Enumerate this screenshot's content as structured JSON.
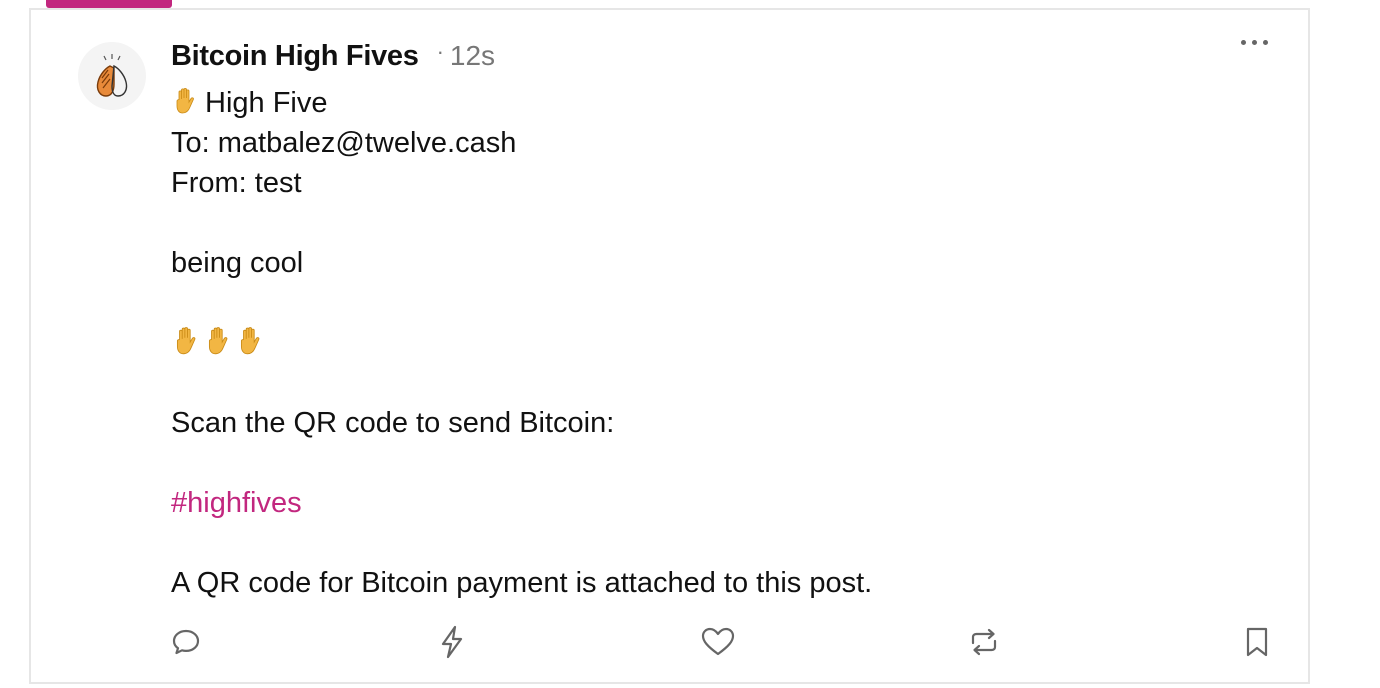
{
  "post": {
    "author": "Bitcoin High Fives",
    "dot": "·",
    "time": "12s",
    "line_title": "High Five",
    "line_to": "To: matbalez@twelve.cash",
    "line_from": "From: test",
    "line_message": "being cool",
    "line_scan": "Scan the QR code to send Bitcoin:",
    "hashtag": "#highfives",
    "line_attachment": "A QR code for Bitcoin payment is attached to this post."
  },
  "icons": {
    "avatar": "clapping-hands-icon",
    "title_emoji": "raised-hand-icon",
    "hands_row": [
      "raised-hand-icon",
      "raised-hand-icon",
      "raised-hand-icon"
    ],
    "more": "more-horizontal-icon",
    "reply": "reply-bubble-icon",
    "zap": "zap-lightning-icon",
    "like": "heart-icon",
    "repost": "repost-icon",
    "bookmark": "bookmark-icon"
  },
  "colors": {
    "accent": "#c2277f",
    "muted_text": "#777777",
    "icon_gray": "#666666",
    "emoji_hand": "#f2b643",
    "avatar_hand": "#e88a3a"
  }
}
